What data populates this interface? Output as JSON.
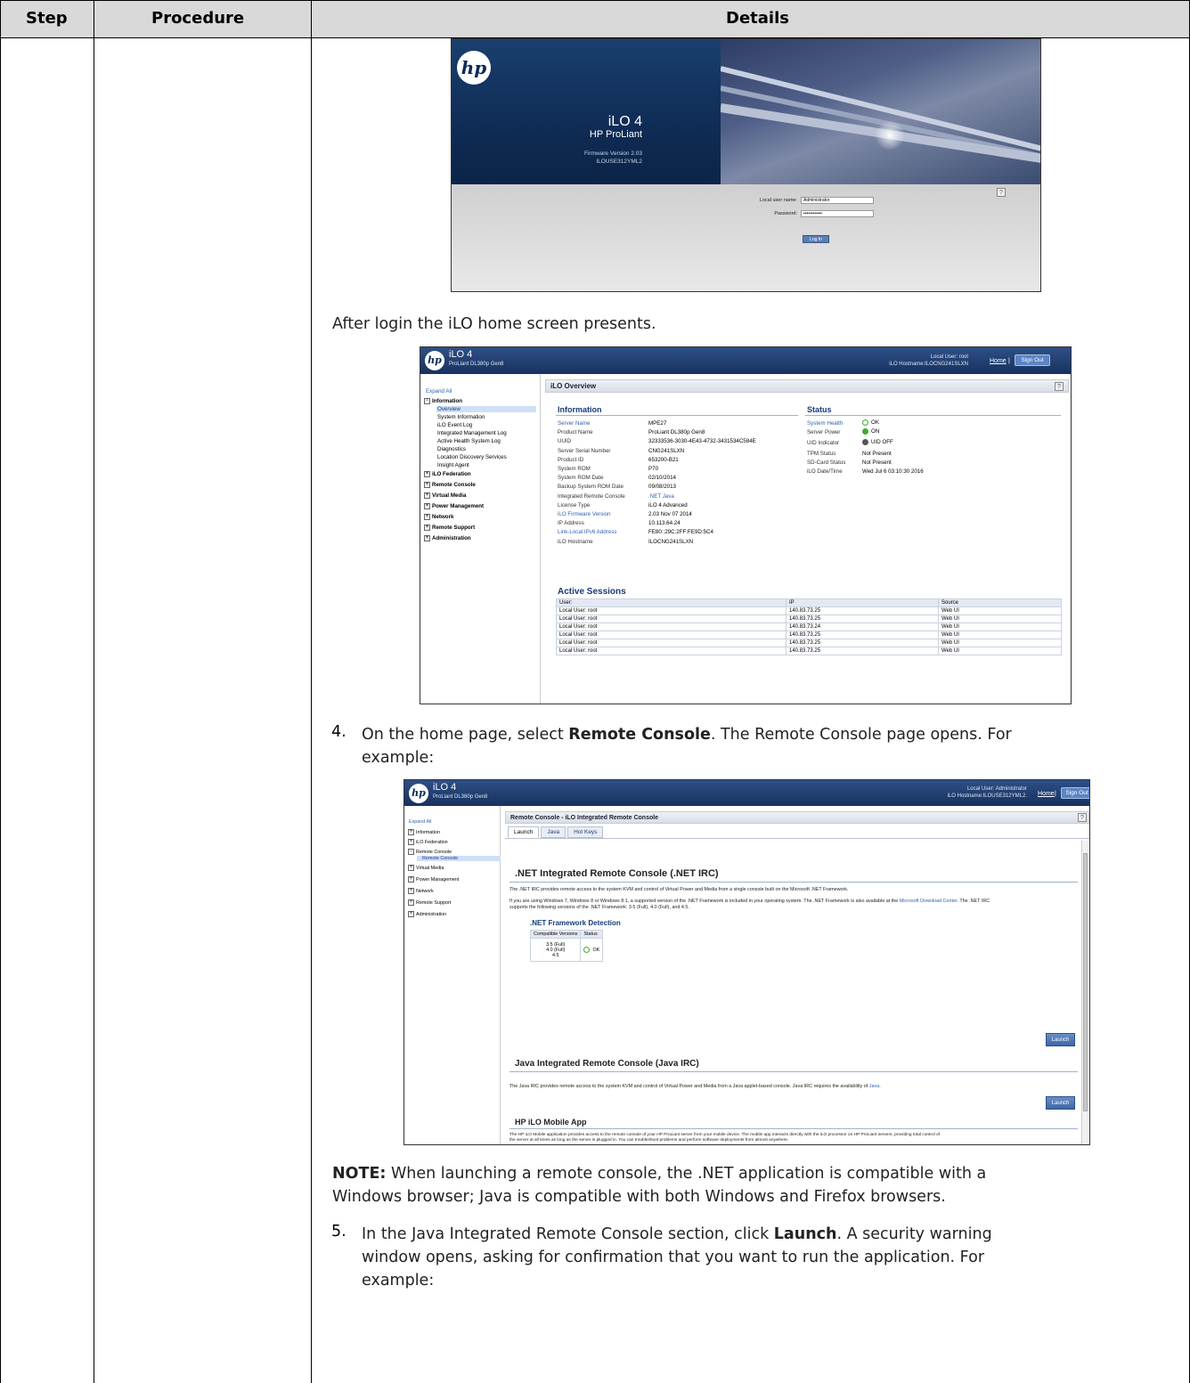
{
  "table": {
    "headers": {
      "step": "Step",
      "procedure": "Procedure",
      "details": "Details"
    }
  },
  "login": {
    "product": "iLO 4",
    "subtitle": "HP ProLiant",
    "firmware_line1": "Firmware Version 2.03",
    "firmware_line2": "ILOUSE312YML2",
    "user_label": "Local user name:",
    "user_value": "Administrator",
    "password_label": "Password:",
    "password_value": "••••••••••••",
    "login_button": "Log In",
    "help": "?",
    "logo": "hp"
  },
  "para_after_login": "After login the iLO home screen presents.",
  "home": {
    "title": "iLO 4",
    "subtitle": "ProLiant DL380p Gen8",
    "user_line": "Local User: root",
    "hostname_line": "iLO Hostname:ILOCNG241SLXN",
    "home_link": "Home",
    "sep": "|",
    "sign_out": "Sign Out",
    "nav": {
      "expand_all": "Expand All",
      "information": "Information",
      "items": [
        "Overview",
        "System Information",
        "iLO Event Log",
        "Integrated Management Log",
        "Active Health System Log",
        "Diagnostics",
        "Location Discovery Services",
        "Insight Agent"
      ],
      "groups": [
        "iLO Federation",
        "Remote Console",
        "Virtual Media",
        "Power Management",
        "Network",
        "Remote Support",
        "Administration"
      ]
    },
    "panel_title": "iLO Overview",
    "info_title": "Information",
    "status_title": "Status",
    "info_rows": [
      {
        "k": "Server Name",
        "v": "MPE27"
      },
      {
        "k": "Product Name",
        "v": "ProLiant DL380p Gen8"
      },
      {
        "k": "UUID",
        "v": "32333536-3030-4E43-4732-3431534C584E"
      },
      {
        "k": "Server Serial Number",
        "v": "CNG241SLXN"
      },
      {
        "k": "Product ID",
        "v": "653200-B21"
      },
      {
        "k": "System ROM",
        "v": "P70"
      },
      {
        "k": "System ROM Date",
        "v": "02/10/2014"
      },
      {
        "k": "Backup System ROM Date",
        "v": "09/08/2013"
      },
      {
        "k": "Integrated Remote Console",
        "v": ".NET  Java"
      },
      {
        "k": "License Type",
        "v": "iLO 4 Advanced"
      },
      {
        "k": "iLO Firmware Version",
        "v": "2.03 Nov 07 2014"
      },
      {
        "k": "IP Address",
        "v": "10.113.64.24"
      },
      {
        "k": "Link-Local IPv6 Address",
        "v": "FE80::29C:2FF:FE9D:5C4"
      },
      {
        "k": "iLO Hostname",
        "v": "ILOCNG241SLXN"
      }
    ],
    "status_rows": [
      {
        "k": "System Health",
        "v": "OK"
      },
      {
        "k": "Server Power",
        "v": "ON"
      },
      {
        "k": "UID Indicator",
        "v": "UID OFF"
      },
      {
        "k": "TPM Status",
        "v": "Not Present"
      },
      {
        "k": "SD-Card Status",
        "v": "Not Present"
      },
      {
        "k": "iLO Date/Time",
        "v": "Wed Jul 6 03:10:30 2016"
      }
    ],
    "sessions_title": "Active Sessions",
    "sessions_headers": [
      "User:",
      "IP",
      "Source"
    ],
    "sessions": [
      [
        "Local User: root",
        "140.83.73.25",
        "Web UI"
      ],
      [
        "Local User: root",
        "140.83.73.25",
        "Web UI"
      ],
      [
        "Local User: root",
        "140.83.73.24",
        "Web UI"
      ],
      [
        "Local User: root",
        "140.83.73.25",
        "Web UI"
      ],
      [
        "Local User: root",
        "140.83.73.25",
        "Web UI"
      ],
      [
        "Local User: root",
        "140.83.73.25",
        "Web UI"
      ]
    ],
    "colors": {
      "link": "#2f63b3",
      "ok": "#3fae2a",
      "off": "#555555"
    }
  },
  "step4": {
    "num": "4.",
    "line1_a": "On the home page, select ",
    "line1_b": "Remote Console",
    "line1_c": ". The Remote Console page opens. For",
    "line2": "example:"
  },
  "rc": {
    "title": "iLO 4",
    "subtitle": "ProLiant DL380p Gen8",
    "user_line": "Local User: Administrator",
    "hostname_line": "iLO Hostname:ILOUSE312YML2.",
    "home_link": "Home",
    "sep": "|",
    "sign_out": "Sign Out",
    "nav": {
      "expand_all": "Expand All",
      "groups": [
        "Information",
        "iLO Federation",
        "Remote Console",
        "Remote Console",
        "Virtual Media",
        "Power Management",
        "Network",
        "Remote Support",
        "Administration"
      ]
    },
    "panel_title": "Remote Console - iLO Integrated Remote Console",
    "tabs": [
      "Launch",
      "Java",
      "Hot Keys"
    ],
    "net_title": ".NET Integrated Remote Console (.NET IRC)",
    "net_p1": "The .NET IRC provides remote access to the system KVM and control of Virtual Power and Media from a single console built on the Microsoft .NET Framework.",
    "net_p2a": "If you are using Windows 7, Windows 8 or Windows 8.1, a supported version of the .NET Framework is included in your operating system. The .NET Framework is also available at the ",
    "net_p2link": "Microsoft Download Center",
    "net_p2b": ". The .NET IRC",
    "net_p3": "supports the following versions of the .NET Framework: 3.5 (Full), 4.0 (Full), and 4.5.",
    "detect_title": ".NET Framework Detection",
    "detect_headers": [
      "Compatible Versions",
      "Status"
    ],
    "detect_versions": [
      "3.5 (Full)",
      "4.0 (Full)",
      "4.5"
    ],
    "detect_status": "OK",
    "launch": "Launch",
    "java_title": "Java Integrated Remote Console (Java IRC)",
    "java_p": "The Java IRC provides remote access to the system KVM and control of Virtual Power and Media from a Java applet-based console. Java IRC requires the availability of ",
    "java_link": "Java",
    "java_end": ".",
    "mobile_title": "HP iLO Mobile App",
    "mobile_p1": "The HP iLO Mobile application provides access to the remote console of your HP ProLiant server from your mobile device. The mobile app interacts directly with the iLO processor on HP ProLiant servers, providing total control of",
    "mobile_p2": "the server at all times as long as the server is plugged in. You can troubleshoot problems and perform software deployments from almost anywhere."
  },
  "note": {
    "label": "NOTE:",
    "line1": " When launching a remote console, the .NET application is compatible with a",
    "line2": "Windows browser; Java is compatible with both Windows and Firefox browsers."
  },
  "step5": {
    "num": "5.",
    "line1_a": "In the Java Integrated Remote Console section, click ",
    "line1_b": "Launch",
    "line1_c": ". A security warning",
    "line2": "window opens, asking for confirmation that you want to run the application. For",
    "line3": "example:"
  }
}
